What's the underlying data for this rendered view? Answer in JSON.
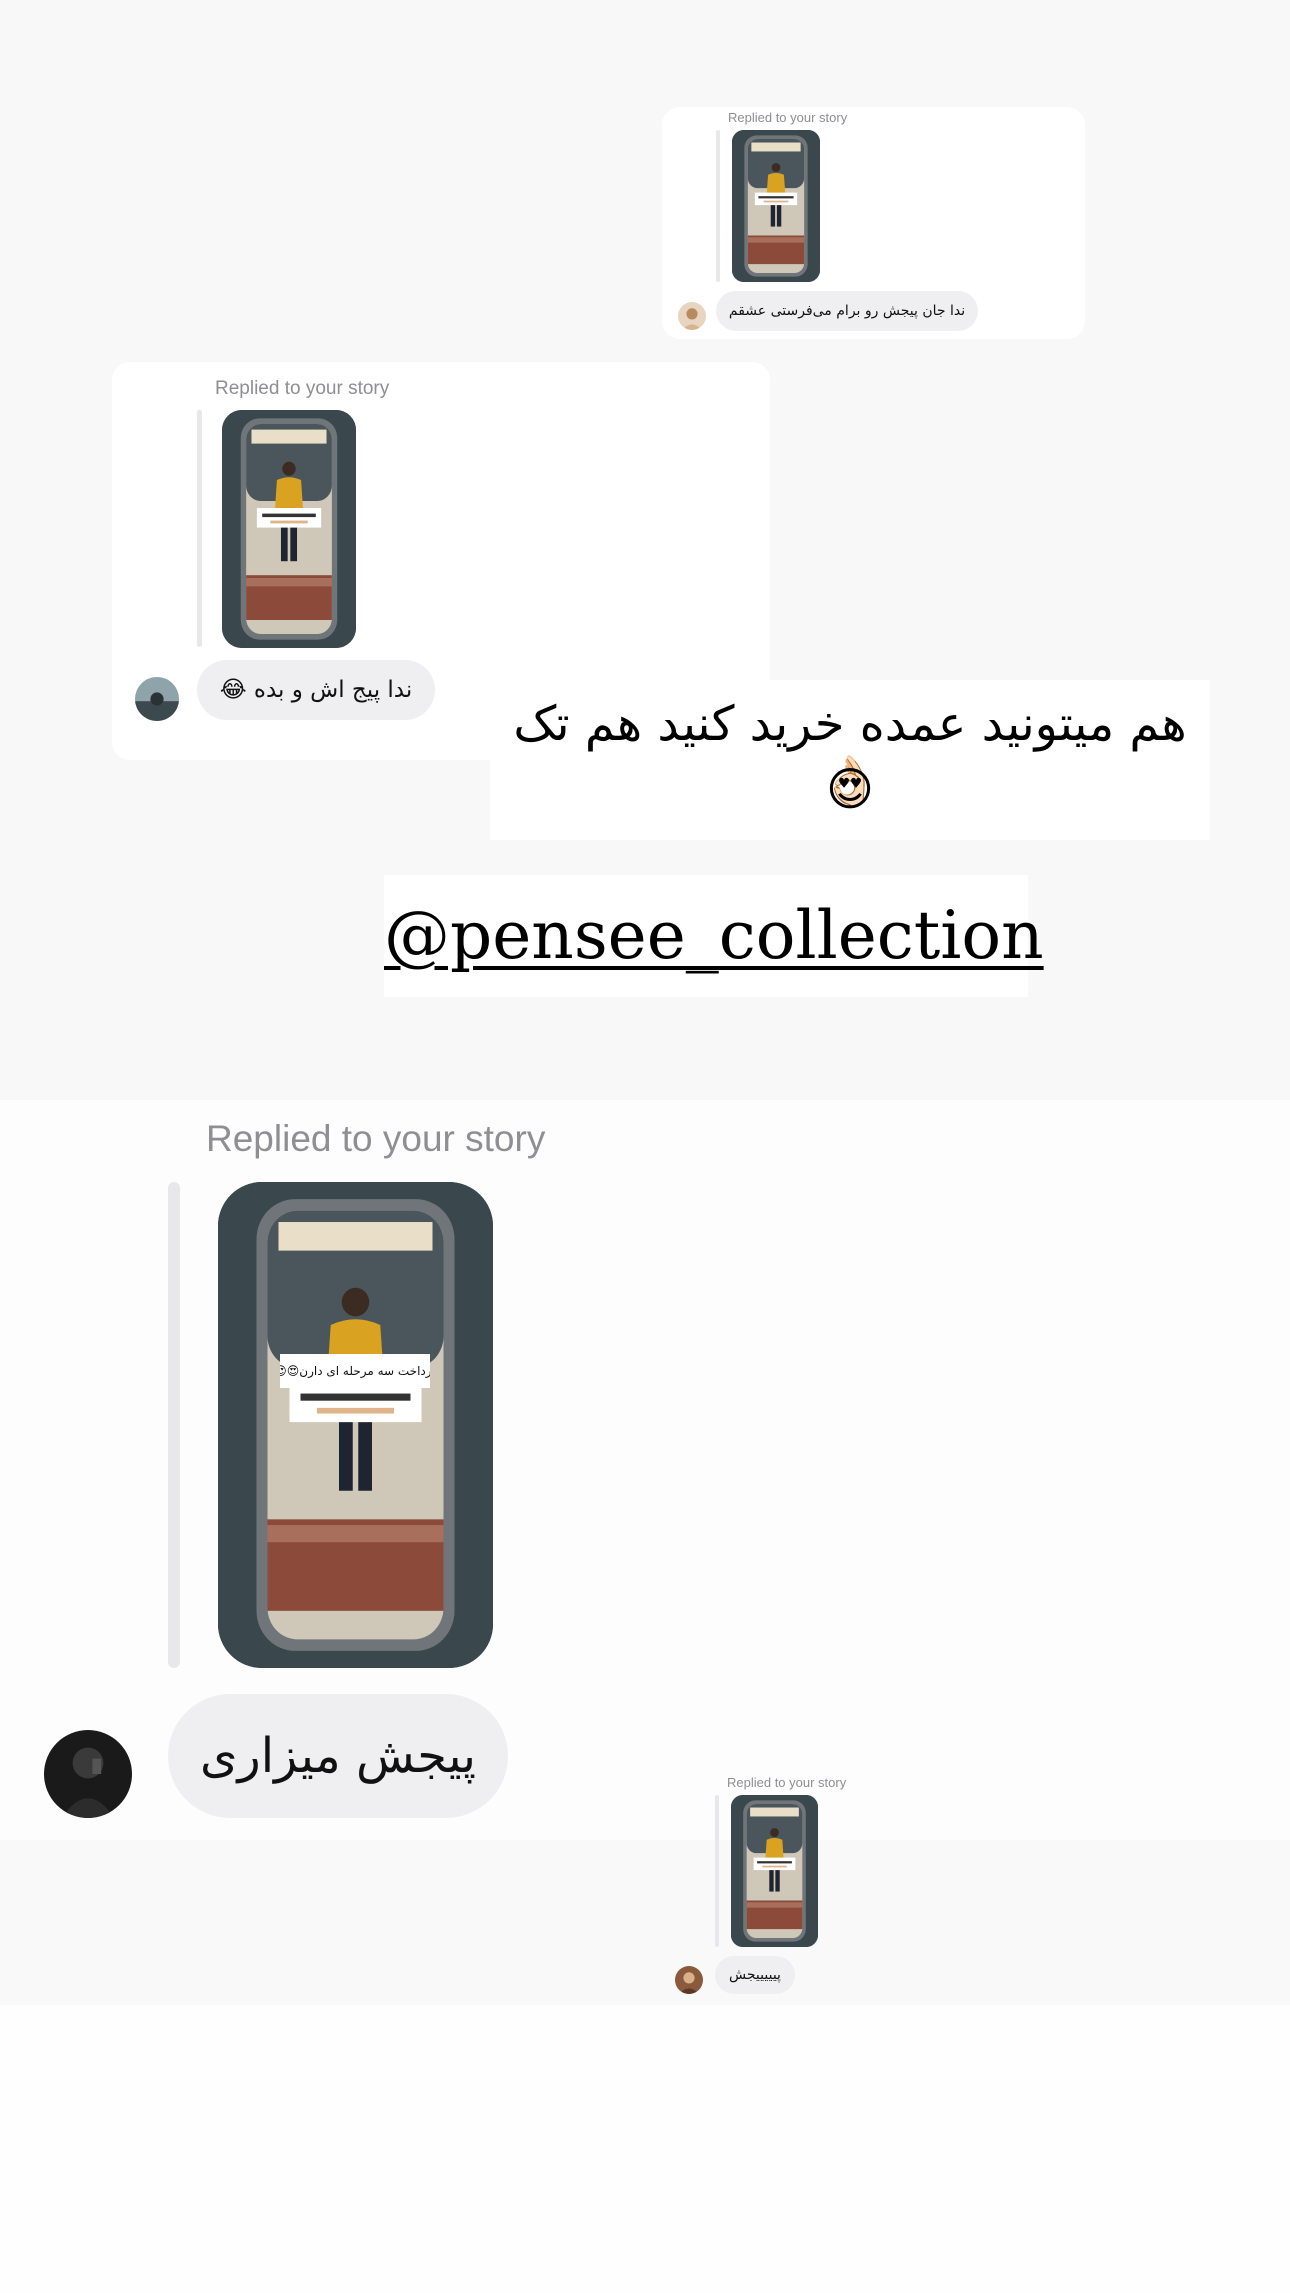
{
  "colors": {
    "bubble_bg": "#efeff2",
    "label_gray": "#8e8e93",
    "text": "#111111",
    "thumb_dark": "#2f3a40",
    "sweater_yellow": "#d9a321"
  },
  "replies": [
    {
      "label": "Replied to your story",
      "sticker_text": "پرداخت سه مرحله ای دارن😍😍",
      "message": "ندا جان پیجش رو برام می‌فرستی عشقم"
    },
    {
      "label": "Replied to your story",
      "sticker_text": "پرداخت سه مرحله ای دارن😍😍",
      "message": "ندا پیج اش و بده 😂"
    },
    {
      "label": "Replied to your story",
      "sticker_text": "پرداخت سه مرحله ای دارن😍😍",
      "message": "پیجش میزاری"
    },
    {
      "label": "Replied to your story",
      "sticker_text": "پرداخت سه مرحله ای دارن😍😍",
      "message": "پیییییجش"
    }
  ],
  "caption": {
    "line1": "هم میتونید عمده خرید کنید هم تک👌🏻",
    "line2": "😍"
  },
  "handle": "@pensee_collection",
  "icons": {
    "story_thumbnail": "mirror-selfie-photo",
    "avatar": "profile-photo"
  }
}
